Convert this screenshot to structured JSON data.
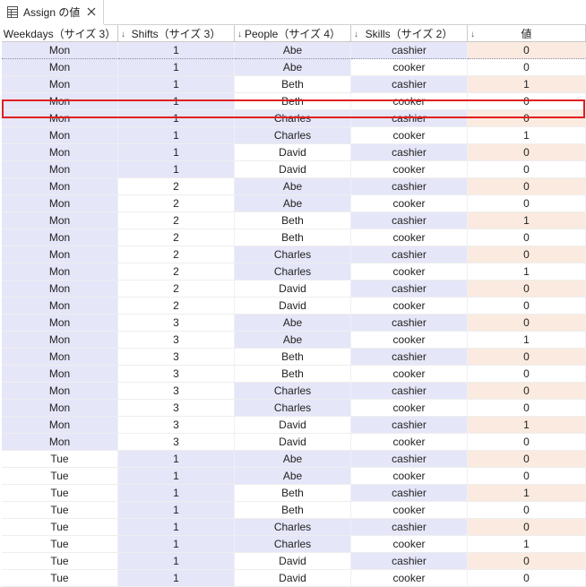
{
  "tab": {
    "title": "Assign の値",
    "icon": "table-icon",
    "close_icon": "close-icon"
  },
  "columns": [
    {
      "label": "Weekdays（サイズ 3）",
      "sort_indicator": "↓"
    },
    {
      "label": "Shifts（サイズ 3）",
      "sort_indicator": "↓"
    },
    {
      "label": "People（サイズ 4）",
      "sort_indicator": "↓"
    },
    {
      "label": "Skills（サイズ 2）",
      "sort_indicator": "↓"
    },
    {
      "label": "値",
      "sort_indicator": "↓"
    }
  ],
  "rows": [
    [
      "Mon",
      "1",
      "Abe",
      "cashier",
      "0"
    ],
    [
      "Mon",
      "1",
      "Abe",
      "cooker",
      "0"
    ],
    [
      "Mon",
      "1",
      "Beth",
      "cashier",
      "1"
    ],
    [
      "Mon",
      "1",
      "Beth",
      "cooker",
      "0"
    ],
    [
      "Mon",
      "1",
      "Charles",
      "cashier",
      "0"
    ],
    [
      "Mon",
      "1",
      "Charles",
      "cooker",
      "1"
    ],
    [
      "Mon",
      "1",
      "David",
      "cashier",
      "0"
    ],
    [
      "Mon",
      "1",
      "David",
      "cooker",
      "0"
    ],
    [
      "Mon",
      "2",
      "Abe",
      "cashier",
      "0"
    ],
    [
      "Mon",
      "2",
      "Abe",
      "cooker",
      "0"
    ],
    [
      "Mon",
      "2",
      "Beth",
      "cashier",
      "1"
    ],
    [
      "Mon",
      "2",
      "Beth",
      "cooker",
      "0"
    ],
    [
      "Mon",
      "2",
      "Charles",
      "cashier",
      "0"
    ],
    [
      "Mon",
      "2",
      "Charles",
      "cooker",
      "1"
    ],
    [
      "Mon",
      "2",
      "David",
      "cashier",
      "0"
    ],
    [
      "Mon",
      "2",
      "David",
      "cooker",
      "0"
    ],
    [
      "Mon",
      "3",
      "Abe",
      "cashier",
      "0"
    ],
    [
      "Mon",
      "3",
      "Abe",
      "cooker",
      "1"
    ],
    [
      "Mon",
      "3",
      "Beth",
      "cashier",
      "0"
    ],
    [
      "Mon",
      "3",
      "Beth",
      "cooker",
      "0"
    ],
    [
      "Mon",
      "3",
      "Charles",
      "cashier",
      "0"
    ],
    [
      "Mon",
      "3",
      "Charles",
      "cooker",
      "0"
    ],
    [
      "Mon",
      "3",
      "David",
      "cashier",
      "1"
    ],
    [
      "Mon",
      "3",
      "David",
      "cooker",
      "0"
    ],
    [
      "Tue",
      "1",
      "Abe",
      "cashier",
      "0"
    ],
    [
      "Tue",
      "1",
      "Abe",
      "cooker",
      "0"
    ],
    [
      "Tue",
      "1",
      "Beth",
      "cashier",
      "1"
    ],
    [
      "Tue",
      "1",
      "Beth",
      "cooker",
      "0"
    ],
    [
      "Tue",
      "1",
      "Charles",
      "cashier",
      "0"
    ],
    [
      "Tue",
      "1",
      "Charles",
      "cooker",
      "1"
    ],
    [
      "Tue",
      "1",
      "David",
      "cashier",
      "0"
    ],
    [
      "Tue",
      "1",
      "David",
      "cooker",
      "0"
    ]
  ],
  "highlighted_row": 2,
  "colors": {
    "dimension_shade": "#e6e6f9",
    "value_shade": "#faeadf",
    "highlight_border": "#e02020"
  }
}
